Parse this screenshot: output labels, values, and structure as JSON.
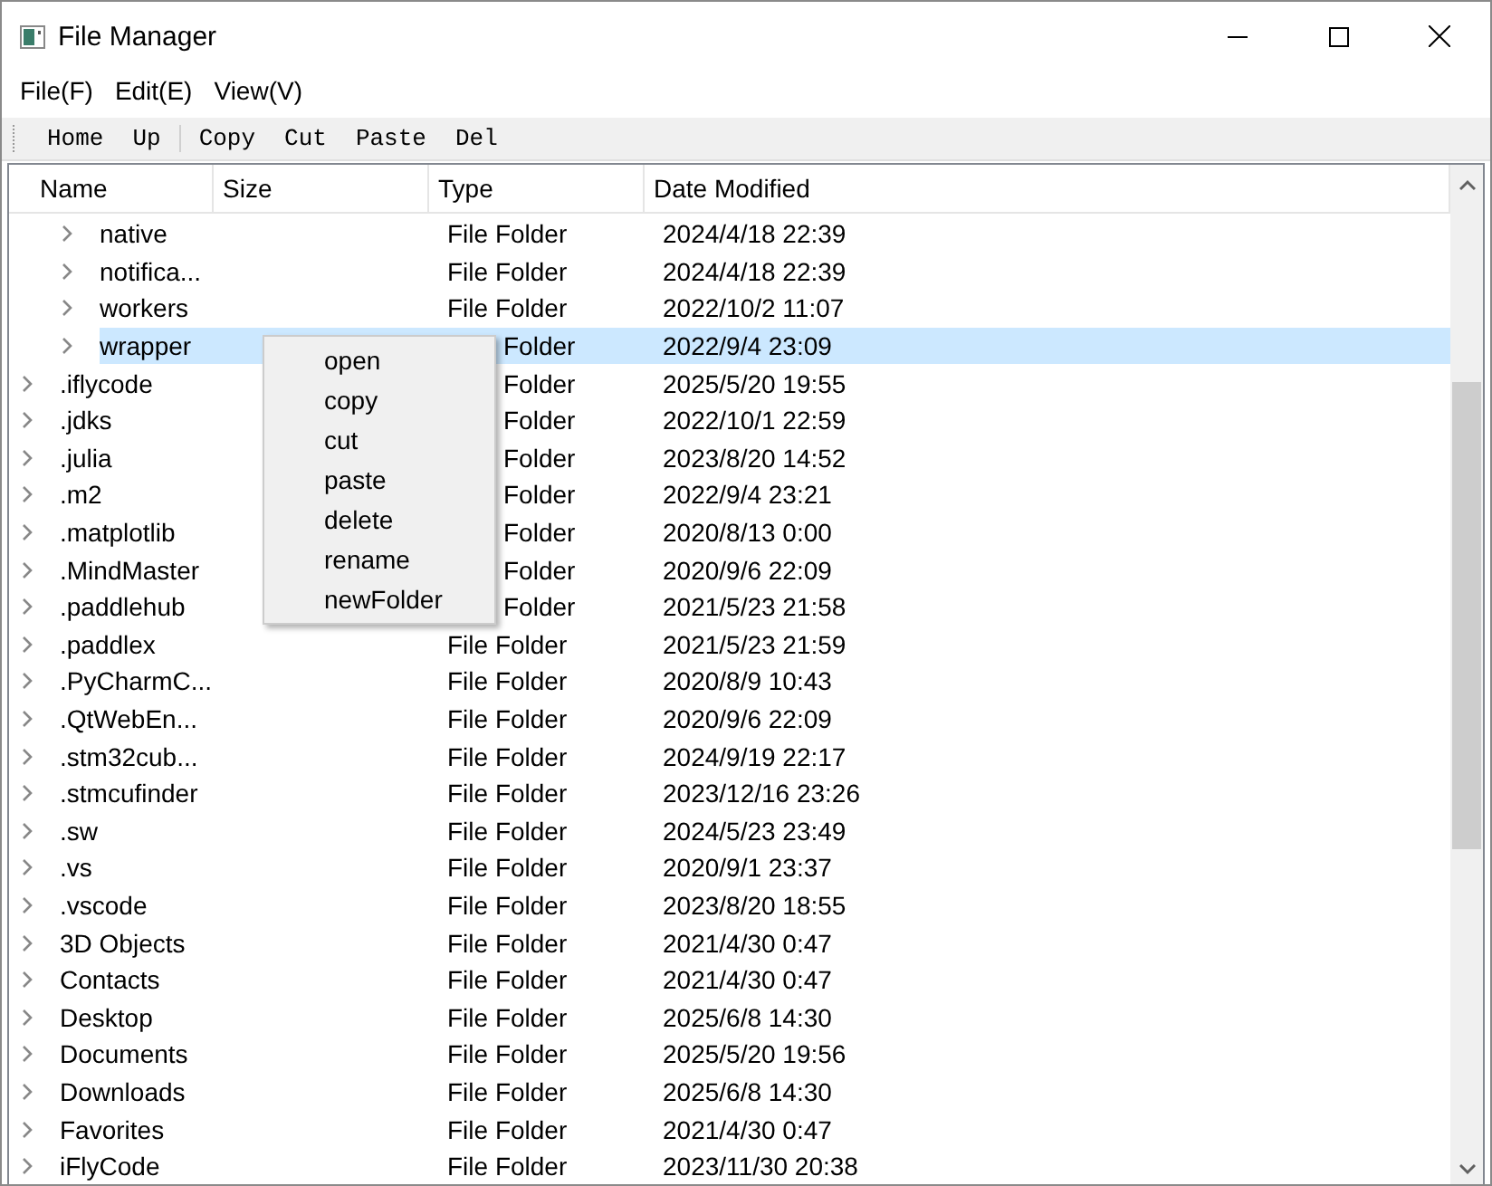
{
  "window": {
    "title": "File Manager"
  },
  "menu_bar": [
    "File(F)",
    "Edit(E)",
    "View(V)"
  ],
  "toolbar": {
    "groups": [
      [
        "Home",
        "Up"
      ],
      [
        "Copy",
        "Cut",
        "Paste",
        "Del"
      ]
    ]
  },
  "tree": {
    "columns": [
      "Name",
      "Size",
      "Type",
      "Date Modified"
    ],
    "items": [
      {
        "children": [
          {
            "name": "native",
            "type": "File Folder",
            "date": "2024/4/18 22:39",
            "selected": false,
            "type_covered": false
          },
          {
            "name": "notifica...",
            "type": "File Folder",
            "date": "2024/4/18 22:39",
            "selected": false,
            "type_covered": false
          },
          {
            "name": "workers",
            "type": "File Folder",
            "date": "2022/10/2 11:07",
            "selected": false,
            "type_covered": false
          },
          {
            "name": "wrapper",
            "type": "Folder",
            "date": "2022/9/4 23:09",
            "selected": true,
            "type_covered": true
          }
        ]
      },
      {
        "name": ".iflycode",
        "type": "Folder",
        "date": "2025/5/20 19:55",
        "selected": false,
        "type_covered": true
      },
      {
        "name": ".jdks",
        "type": "Folder",
        "date": "2022/10/1 22:59",
        "selected": false,
        "type_covered": true
      },
      {
        "name": ".julia",
        "type": "Folder",
        "date": "2023/8/20 14:52",
        "selected": false,
        "type_covered": true
      },
      {
        "name": ".m2",
        "type": "Folder",
        "date": "2022/9/4 23:21",
        "selected": false,
        "type_covered": true
      },
      {
        "name": ".matplotlib",
        "type": "Folder",
        "date": "2020/8/13 0:00",
        "selected": false,
        "type_covered": true
      },
      {
        "name": ".MindMaster",
        "type": "Folder",
        "date": "2020/9/6 22:09",
        "selected": false,
        "type_covered": true
      },
      {
        "name": ".paddlehub",
        "type": "Folder",
        "date": "2021/5/23 21:58",
        "selected": false,
        "type_covered": true
      },
      {
        "name": ".paddlex",
        "type": "File Folder",
        "date": "2021/5/23 21:59",
        "selected": false,
        "type_covered": false
      },
      {
        "name": ".PyCharmC...",
        "type": "File Folder",
        "date": "2020/8/9 10:43",
        "selected": false,
        "type_covered": false
      },
      {
        "name": ".QtWebEn...",
        "type": "File Folder",
        "date": "2020/9/6 22:09",
        "selected": false,
        "type_covered": false
      },
      {
        "name": ".stm32cub...",
        "type": "File Folder",
        "date": "2024/9/19 22:17",
        "selected": false,
        "type_covered": false
      },
      {
        "name": ".stmcufinder",
        "type": "File Folder",
        "date": "2023/12/16 23:26",
        "selected": false,
        "type_covered": false
      },
      {
        "name": ".sw",
        "type": "File Folder",
        "date": "2024/5/23 23:49",
        "selected": false,
        "type_covered": false
      },
      {
        "name": ".vs",
        "type": "File Folder",
        "date": "2020/9/1 23:37",
        "selected": false,
        "type_covered": false
      },
      {
        "name": ".vscode",
        "type": "File Folder",
        "date": "2023/8/20 18:55",
        "selected": false,
        "type_covered": false
      },
      {
        "name": "3D Objects",
        "type": "File Folder",
        "date": "2021/4/30 0:47",
        "selected": false,
        "type_covered": false
      },
      {
        "name": "Contacts",
        "type": "File Folder",
        "date": "2021/4/30 0:47",
        "selected": false,
        "type_covered": false
      },
      {
        "name": "Desktop",
        "type": "File Folder",
        "date": "2025/6/8 14:30",
        "selected": false,
        "type_covered": false
      },
      {
        "name": "Documents",
        "type": "File Folder",
        "date": "2025/5/20 19:56",
        "selected": false,
        "type_covered": false
      },
      {
        "name": "Downloads",
        "type": "File Folder",
        "date": "2025/6/8 14:30",
        "selected": false,
        "type_covered": false
      },
      {
        "name": "Favorites",
        "type": "File Folder",
        "date": "2021/4/30 0:47",
        "selected": false,
        "type_covered": false
      },
      {
        "name": "iFlyCode",
        "type": "File Folder",
        "date": "2023/11/30 20:38",
        "selected": false,
        "type_covered": false
      }
    ]
  },
  "context_menu": [
    "open",
    "copy",
    "cut",
    "paste",
    "delete",
    "rename",
    "newFolder"
  ]
}
